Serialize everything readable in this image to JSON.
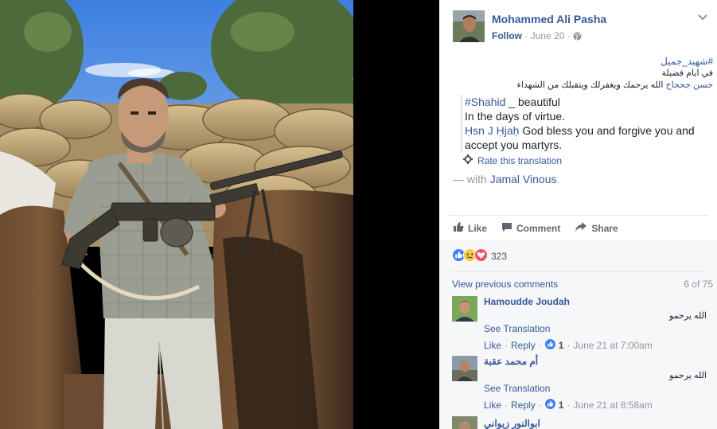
{
  "header": {
    "name": "Mohammed Ali Pasha",
    "follow": "Follow",
    "dot": "·",
    "date": "June 20",
    "dot2": "·"
  },
  "post": {
    "hashtag": "#شهيد_جميل",
    "line1": "في ايام فضيلة",
    "mention": "حسن جحجاح",
    "line2": "الله يرحمك ويغفرلك ويتقبلك من الشهداء",
    "translation": {
      "hashtag": "#Shahid",
      "t1": " _ beautiful",
      "t2": "In the days of virtue.",
      "mention": "Ḥsn J Ḥjaḥ",
      "t3": " God bless you and forgive you and accept you martyrs."
    },
    "rate": "Rate this translation",
    "with_prefix": "— with ",
    "with_name": "Jamal Vinous",
    "with_suffix": "."
  },
  "actions": {
    "like": "Like",
    "comment": "Comment",
    "share": "Share"
  },
  "reactions": {
    "count": "323"
  },
  "comments_nav": {
    "view_previous": "View previous comments",
    "count": "6 of 75"
  },
  "comments": [
    {
      "name": "Hamoudde Joudah",
      "text": "الله يرحمو",
      "see": "See Translation",
      "like": "Like",
      "reply": "Reply",
      "likes": "1",
      "time": "June 21 at 7:00am"
    },
    {
      "name": "أم محمد عقبة",
      "text": "الله يرحمو",
      "see": "See Translation",
      "like": "Like",
      "reply": "Reply",
      "likes": "1",
      "time": "June 21 at 8:58am"
    },
    {
      "name": "ابوالنور زيواني"
    }
  ],
  "colors": {
    "link": "#365899",
    "muted": "#90949c",
    "like_blue": "#4080ff",
    "love_red": "#f25268"
  }
}
